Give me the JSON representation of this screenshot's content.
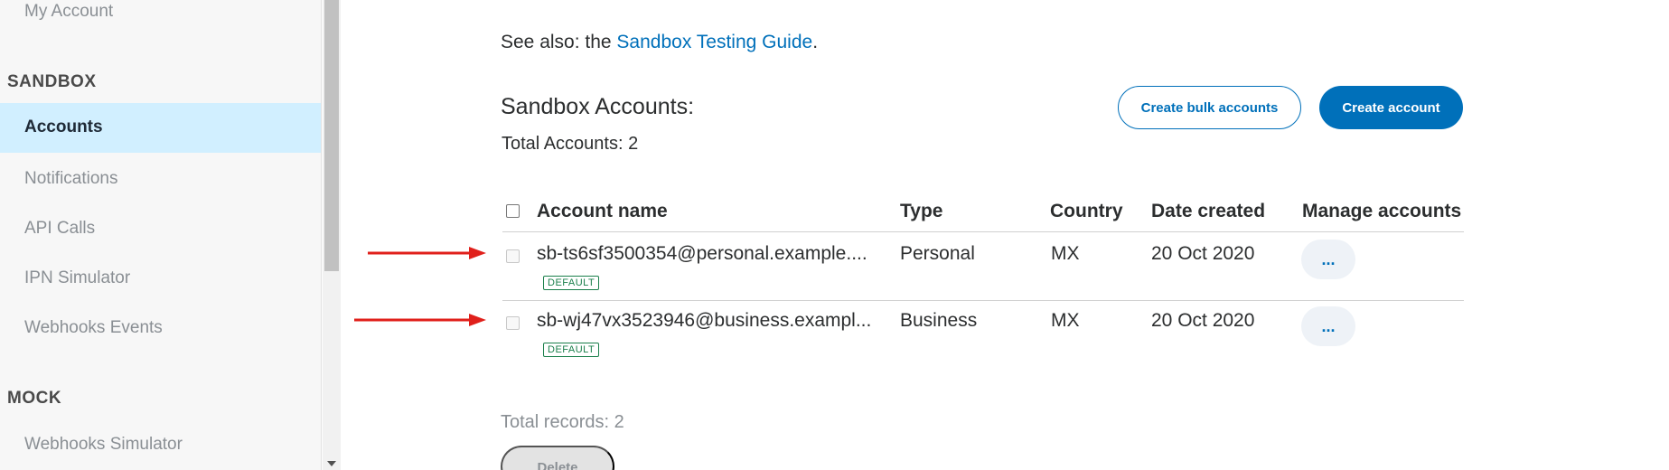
{
  "sidebar": {
    "my_account": "My Account",
    "sandbox_section": "SANDBOX",
    "items": [
      "Accounts",
      "Notifications",
      "API Calls",
      "IPN Simulator",
      "Webhooks Events"
    ],
    "mock_section": "MOCK",
    "mock_items": [
      "Webhooks Simulator"
    ]
  },
  "main": {
    "see_also_prefix": "See also: the ",
    "see_also_link": "Sandbox Testing Guide",
    "see_also_suffix": ".",
    "title": "Sandbox Accounts:",
    "total_accounts": "Total Accounts: 2",
    "create_bulk_label": "Create bulk accounts",
    "create_account_label": "Create account"
  },
  "table": {
    "headers": [
      "Account name",
      "Type",
      "Country",
      "Date created",
      "Manage accounts"
    ],
    "rows": [
      {
        "name": "sb-ts6sf3500354@personal.example....",
        "badge": "DEFAULT",
        "type": "Personal",
        "country": "MX",
        "date": "20 Oct 2020",
        "manage": "..."
      },
      {
        "name": "sb-wj47vx3523946@business.exampl...",
        "badge": "DEFAULT",
        "type": "Business",
        "country": "MX",
        "date": "20 Oct 2020",
        "manage": "..."
      }
    ]
  },
  "footer": {
    "total_records": "Total records: 2",
    "delete_label": "Delete"
  },
  "colors": {
    "accent": "#0070ba",
    "active_bg": "#d1efff",
    "badge": "#1a7f4b",
    "annotation_arrow": "#e0201b"
  }
}
